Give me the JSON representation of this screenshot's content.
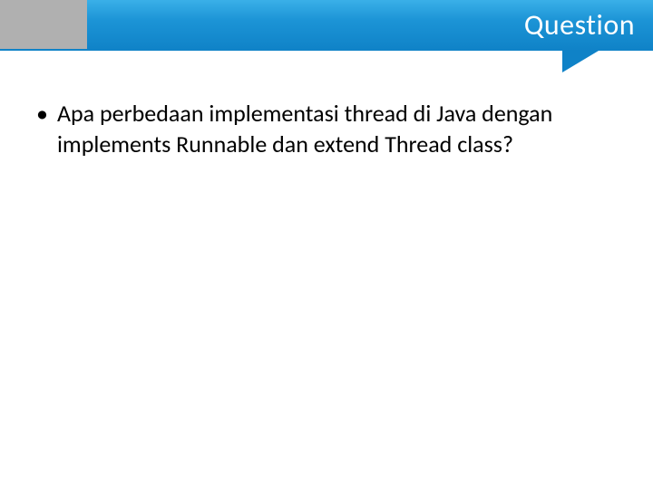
{
  "header": {
    "title": "Question"
  },
  "content": {
    "bullets": [
      {
        "text": "Apa perbedaan implementasi thread di Java dengan implements Runnable dan extend Thread class?"
      }
    ]
  }
}
